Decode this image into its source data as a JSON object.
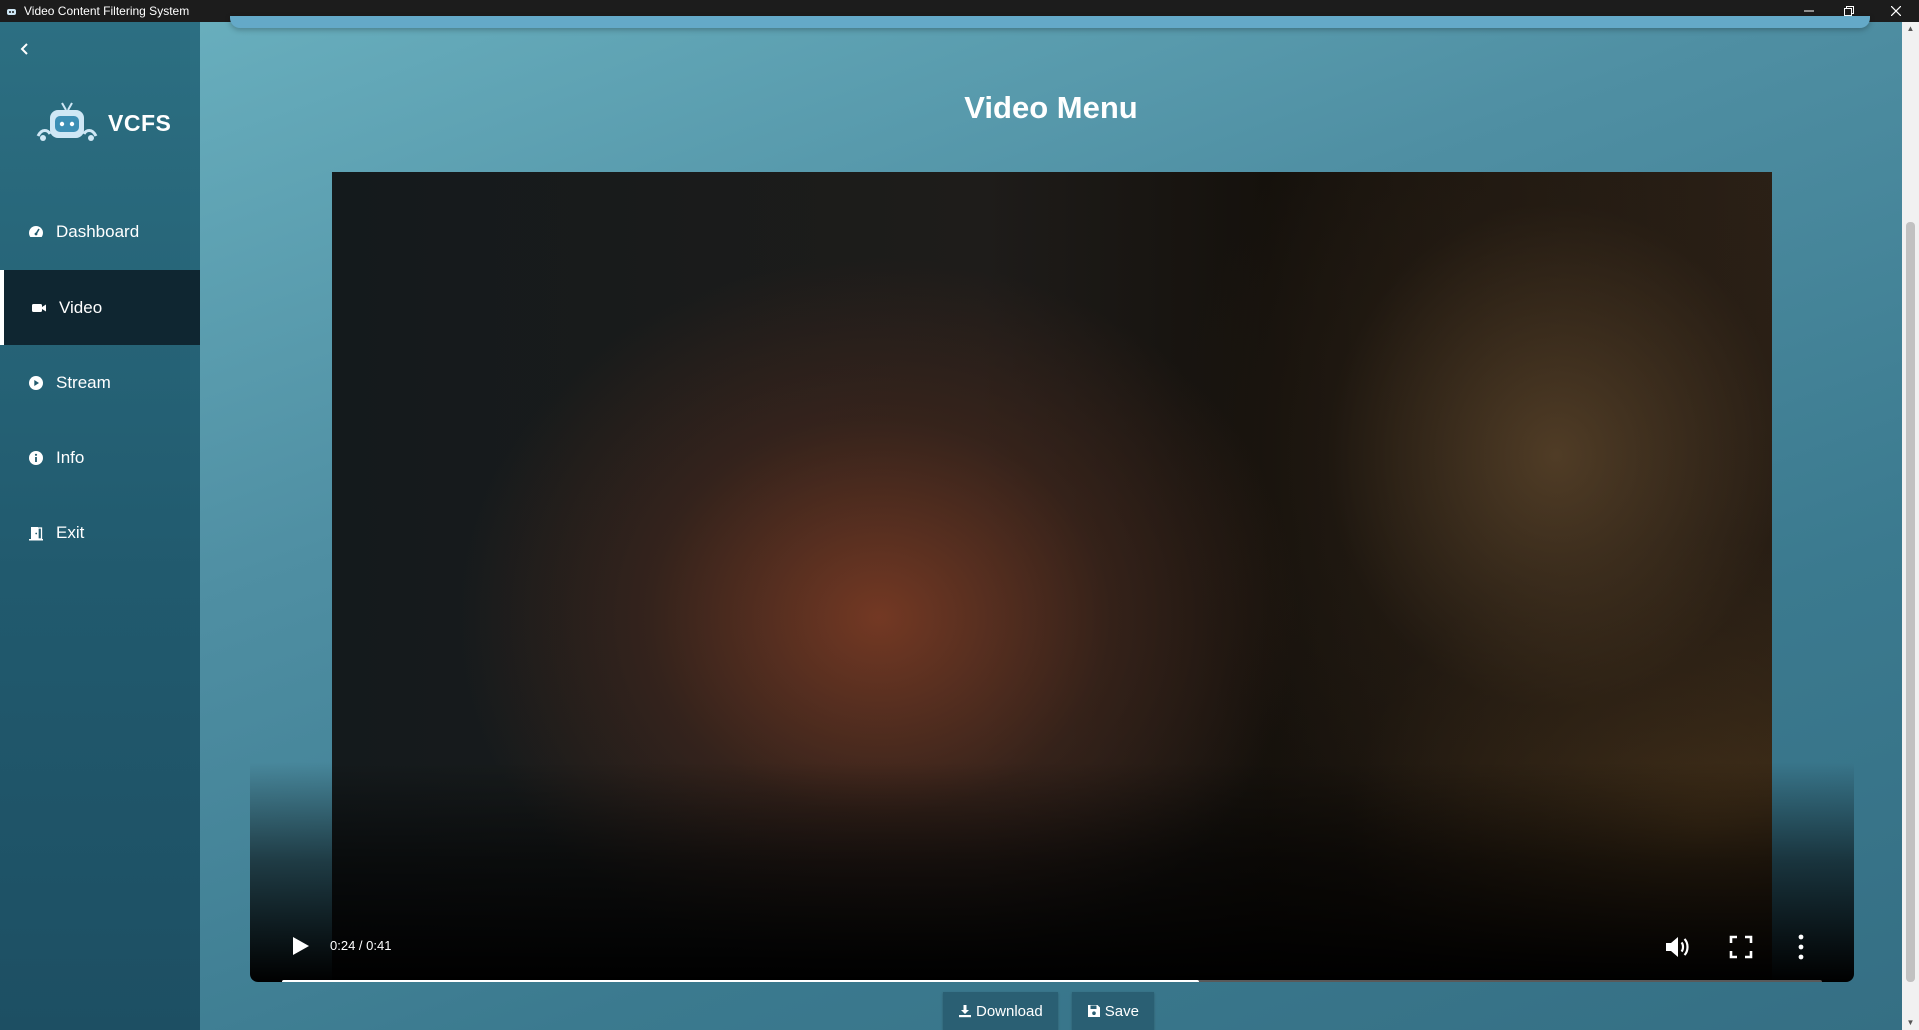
{
  "window": {
    "title": "Video Content Filtering System"
  },
  "brand": {
    "name": "VCFS"
  },
  "sidebar": {
    "items": [
      {
        "label": "Dashboard",
        "icon": "dashboard-icon",
        "active": false
      },
      {
        "label": "Video",
        "icon": "video-camera-icon",
        "active": true
      },
      {
        "label": "Stream",
        "icon": "play-circle-icon",
        "active": false
      },
      {
        "label": "Info",
        "icon": "info-icon",
        "active": false
      },
      {
        "label": "Exit",
        "icon": "door-exit-icon",
        "active": false
      }
    ]
  },
  "main": {
    "title": "Video Menu"
  },
  "player": {
    "time": "0:24 / 0:41",
    "progress": 0.5953
  },
  "actions": {
    "download_label": "Download",
    "save_label": "Save"
  },
  "colors": {
    "sidebar": "#215a6e",
    "active_item": "#0f2631",
    "button": "#2a5f73"
  }
}
